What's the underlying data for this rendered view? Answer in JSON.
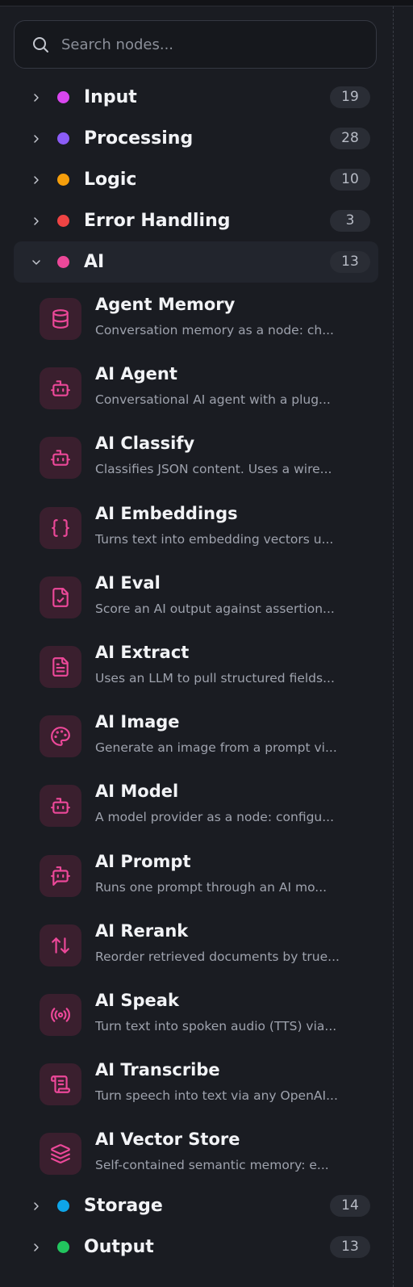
{
  "search": {
    "placeholder": "Search nodes..."
  },
  "categories_top": [
    {
      "label": "Input",
      "count": "19",
      "color": "#d946ef"
    },
    {
      "label": "Processing",
      "count": "28",
      "color": "#8b5cf6"
    },
    {
      "label": "Logic",
      "count": "10",
      "color": "#f59e0b"
    },
    {
      "label": "Error Handling",
      "count": "3",
      "color": "#ef4444"
    }
  ],
  "ai_category": {
    "label": "AI",
    "count": "13",
    "color": "#ec4899",
    "expanded": true
  },
  "ai_nodes": [
    {
      "title": "Agent Memory",
      "desc": "Conversation memory as a node: ch...",
      "icon": "database-icon"
    },
    {
      "title": "AI Agent",
      "desc": "Conversational AI agent with a plug...",
      "icon": "bot-icon"
    },
    {
      "title": "AI Classify",
      "desc": "Classifies JSON content. Uses a wire...",
      "icon": "bot-icon"
    },
    {
      "title": "AI Embeddings",
      "desc": "Turns text into embedding vectors u...",
      "icon": "braces-icon"
    },
    {
      "title": "AI Eval",
      "desc": "Score an AI output against assertion...",
      "icon": "file-check-icon"
    },
    {
      "title": "AI Extract",
      "desc": "Uses an LLM to pull structured fields...",
      "icon": "file-text-icon"
    },
    {
      "title": "AI Image",
      "desc": "Generate an image from a prompt vi...",
      "icon": "palette-icon"
    },
    {
      "title": "AI Model",
      "desc": "A model provider as a node: configu...",
      "icon": "bot-icon"
    },
    {
      "title": "AI Prompt",
      "desc": "Runs one prompt through an AI mo...",
      "icon": "bot-message-icon"
    },
    {
      "title": "AI Rerank",
      "desc": "Reorder retrieved documents by true...",
      "icon": "arrow-up-down-icon"
    },
    {
      "title": "AI Speak",
      "desc": "Turn text into spoken audio (TTS) via...",
      "icon": "radio-icon"
    },
    {
      "title": "AI Transcribe",
      "desc": "Turn speech into text via any OpenAI...",
      "icon": "scroll-text-icon"
    },
    {
      "title": "AI Vector Store",
      "desc": "Self-contained semantic memory: e...",
      "icon": "layers-icon"
    }
  ],
  "categories_bottom": [
    {
      "label": "Storage",
      "count": "14",
      "color": "#0ea5e9"
    },
    {
      "label": "Output",
      "count": "13",
      "color": "#22c55e"
    }
  ],
  "accent_color": "#ec4899"
}
